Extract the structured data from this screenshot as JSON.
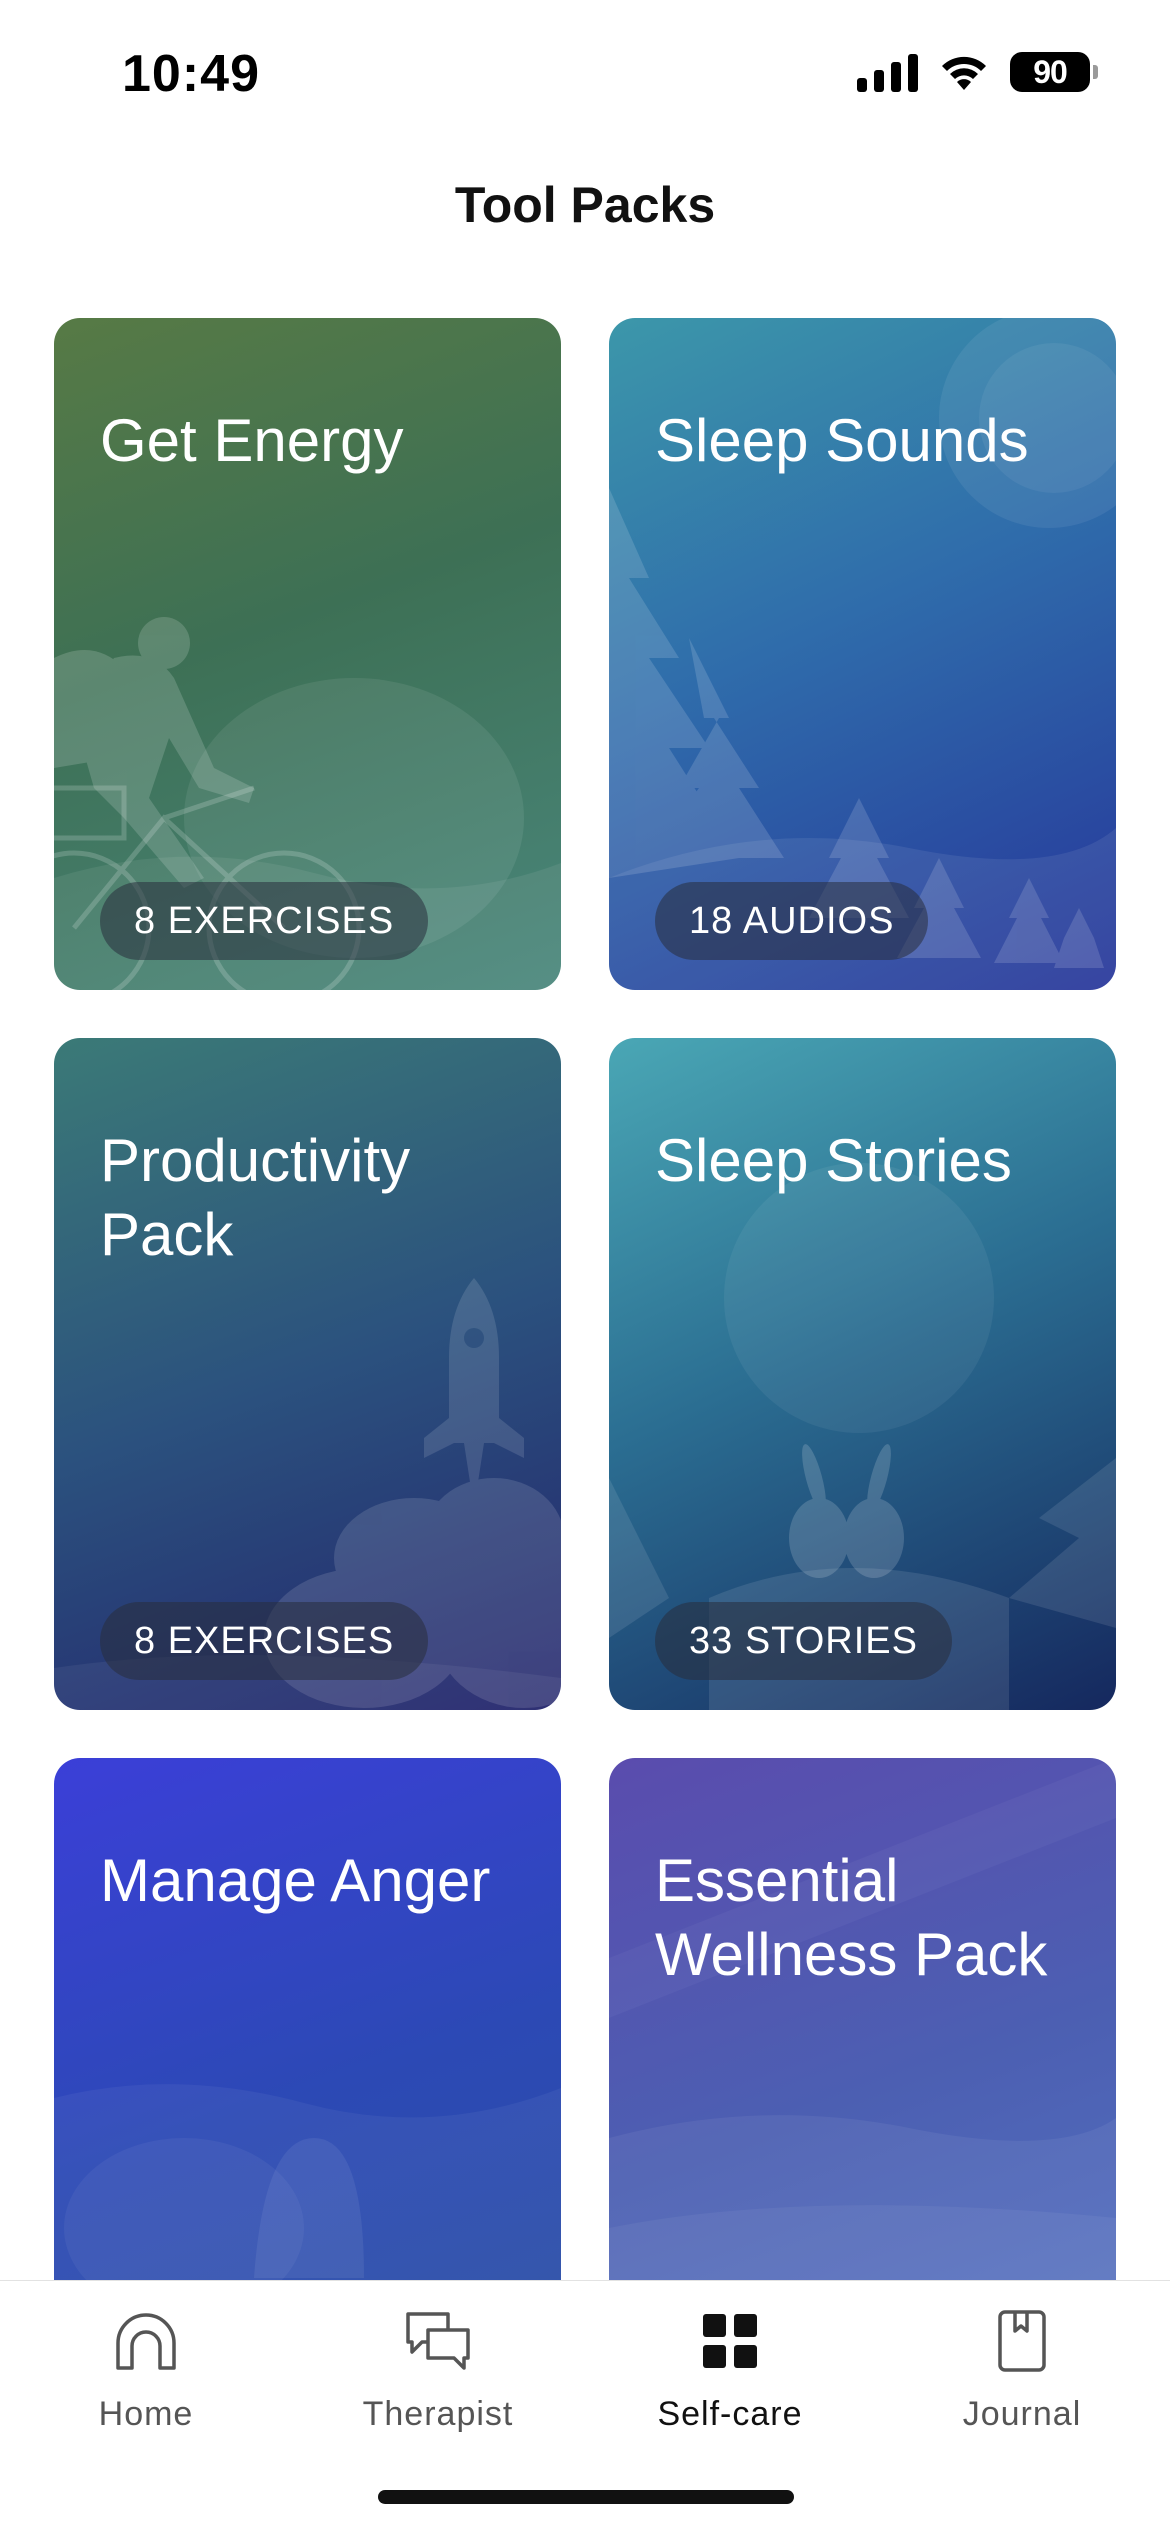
{
  "status_bar": {
    "time": "10:49",
    "battery": "90",
    "icons": [
      "signal-icon",
      "wifi-icon",
      "battery-icon"
    ]
  },
  "page": {
    "title": "Tool Packs"
  },
  "packs": [
    {
      "title": "Get Energy",
      "badge": "8 EXERCISES",
      "art": "cyclist-illustration",
      "colors": [
        "#577a45",
        "#4a877c"
      ]
    },
    {
      "title": "Sleep Sounds",
      "badge": "18 AUDIOS",
      "art": "forest-moon-illustration",
      "colors": [
        "#3c97aa",
        "#26359a"
      ]
    },
    {
      "title": "Productivity Pack",
      "badge": "8 EXERCISES",
      "art": "rocket-illustration",
      "colors": [
        "#3b7a77",
        "#23246c"
      ]
    },
    {
      "title": "Sleep Stories",
      "badge": "33 STORIES",
      "art": "rabbits-moon-illustration",
      "colors": [
        "#4aa7b5",
        "#15285e"
      ]
    },
    {
      "title": "Manage Anger",
      "badge": "",
      "art": "hills-illustration",
      "colors": [
        "#3b3fd8",
        "#2a4fa1"
      ]
    },
    {
      "title": "Essential Wellness Pack",
      "badge": "",
      "art": "waves-illustration",
      "colors": [
        "#5a4cae",
        "#5575c3"
      ]
    }
  ],
  "tab_bar": {
    "items": [
      {
        "label": "Home",
        "icon": "home-arch-icon",
        "active": false
      },
      {
        "label": "Therapist",
        "icon": "chat-bubbles-icon",
        "active": false
      },
      {
        "label": "Self-care",
        "icon": "grid-icon",
        "active": true
      },
      {
        "label": "Journal",
        "icon": "bookmark-book-icon",
        "active": false
      }
    ]
  }
}
